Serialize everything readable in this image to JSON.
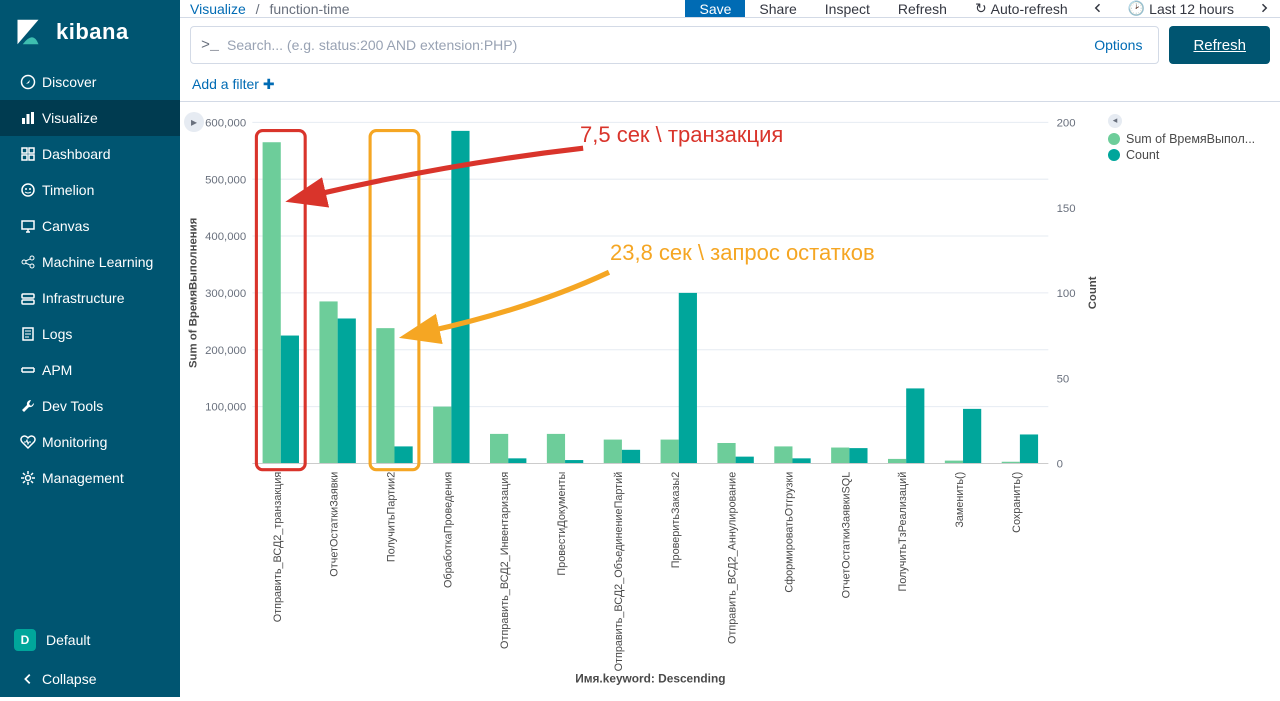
{
  "brand": "kibana",
  "nav": [
    {
      "icon": "compass",
      "label": "Discover"
    },
    {
      "icon": "bar",
      "label": "Visualize",
      "active": true
    },
    {
      "icon": "dash",
      "label": "Dashboard"
    },
    {
      "icon": "lion",
      "label": "Timelion"
    },
    {
      "icon": "canvas",
      "label": "Canvas"
    },
    {
      "icon": "ml",
      "label": "Machine Learning"
    },
    {
      "icon": "infra",
      "label": "Infrastructure"
    },
    {
      "icon": "logs",
      "label": "Logs"
    },
    {
      "icon": "apm",
      "label": "APM"
    },
    {
      "icon": "wrench",
      "label": "Dev Tools"
    },
    {
      "icon": "heart",
      "label": "Monitoring"
    },
    {
      "icon": "gear",
      "label": "Management"
    }
  ],
  "space": {
    "badge": "D",
    "label": "Default"
  },
  "collapse_label": "Collapse",
  "breadcrumb": {
    "root": "Visualize",
    "current": "function-time"
  },
  "top_actions": {
    "save": "Save",
    "share": "Share",
    "inspect": "Inspect",
    "refresh": "Refresh",
    "auto_refresh": "Auto-refresh",
    "timerange": "Last 12 hours"
  },
  "search": {
    "prompt": ">_",
    "placeholder": "Search... (e.g. status:200 AND extension:PHP)",
    "options": "Options"
  },
  "refresh_button": "Refresh",
  "add_filter": "Add a filter",
  "legend": [
    {
      "color": "#6dcd9a",
      "label": "Sum of ВремяВыпол..."
    },
    {
      "color": "#00a69b",
      "label": "Count"
    }
  ],
  "annotations": {
    "red": "7,5 сек \\ транзакция",
    "yellow": "23,8 сек \\ запрос остатков"
  },
  "chart_data": {
    "type": "bar",
    "xlabel": "Имя.keyword: Descending",
    "ylabel_left": "Sum of ВремяВыполнения",
    "ylabel_right": "Count",
    "ylim_left": [
      0,
      600000
    ],
    "ylim_right": [
      0,
      200
    ],
    "yticks_left": [
      0,
      100000,
      200000,
      300000,
      400000,
      500000,
      600000
    ],
    "yticks_left_labels": [
      "",
      "100,000",
      "200,000",
      "300,000",
      "400,000",
      "500,000",
      "600,000"
    ],
    "yticks_right": [
      0,
      50,
      100,
      150,
      200
    ],
    "categories": [
      "Отправить_ВСД2_транзакция",
      "ОтчетОстаткиЗаявки",
      "ПолучитьПартии2",
      "ОбработкаПроведения",
      "Отправить_ВСД2_Инвентаризация",
      "ПровестиДокументы",
      "Отправить_ВСД2_ОбъединениеПартий",
      "ПроверитьЗаказы2",
      "Отправить_ВСД2_Аннулирование",
      "СформироватьОтгрузки",
      "ОтчетОстаткиЗаявкиSQL",
      "ПолучитьТзРеализаций",
      "Заменить()",
      "Сохранить()"
    ],
    "series": [
      {
        "name": "Sum of ВремяВыполнения",
        "axis": "left",
        "color": "#6dcd9a",
        "values": [
          565000,
          285000,
          238000,
          100000,
          52000,
          52000,
          42000,
          42000,
          36000,
          30000,
          28000,
          8000,
          5000,
          3000
        ]
      },
      {
        "name": "Count",
        "axis": "right",
        "color": "#00a69b",
        "values": [
          75,
          85,
          10,
          195,
          3,
          2,
          8,
          100,
          4,
          3,
          9,
          44,
          32,
          17
        ]
      }
    ],
    "callout_boxes": [
      {
        "index": 0,
        "color": "#d9342b"
      },
      {
        "index": 2,
        "color": "#f5a623"
      }
    ]
  }
}
